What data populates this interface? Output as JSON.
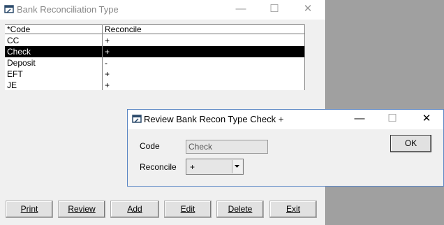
{
  "main_window": {
    "title": "Bank Reconciliation Type",
    "title_controls": {
      "minimize": "—",
      "maximize": "☐",
      "close": "✕"
    },
    "grid": {
      "columns": [
        "*Code",
        "Reconcile"
      ],
      "rows": [
        {
          "code": "CC",
          "reconcile": "+"
        },
        {
          "code": "Check",
          "reconcile": "+"
        },
        {
          "code": "Deposit",
          "reconcile": "-"
        },
        {
          "code": "EFT",
          "reconcile": "+"
        },
        {
          "code": "JE",
          "reconcile": "+"
        }
      ],
      "selected_row": "Check"
    },
    "buttons": {
      "print": "Print",
      "review": "Review",
      "add": "Add",
      "edit": "Edit",
      "delete": "Delete",
      "exit": "Exit"
    }
  },
  "dialog": {
    "title": "Review Bank Recon Type Check +",
    "title_controls": {
      "minimize": "—",
      "maximize": "☐",
      "close": "✕"
    },
    "code_label": "Code",
    "code_value": "Check",
    "reconcile_label": "Reconcile",
    "reconcile_value": "+",
    "ok_button": "OK"
  },
  "icons": [
    "window-icon",
    "dropdown-arrow-icon"
  ]
}
